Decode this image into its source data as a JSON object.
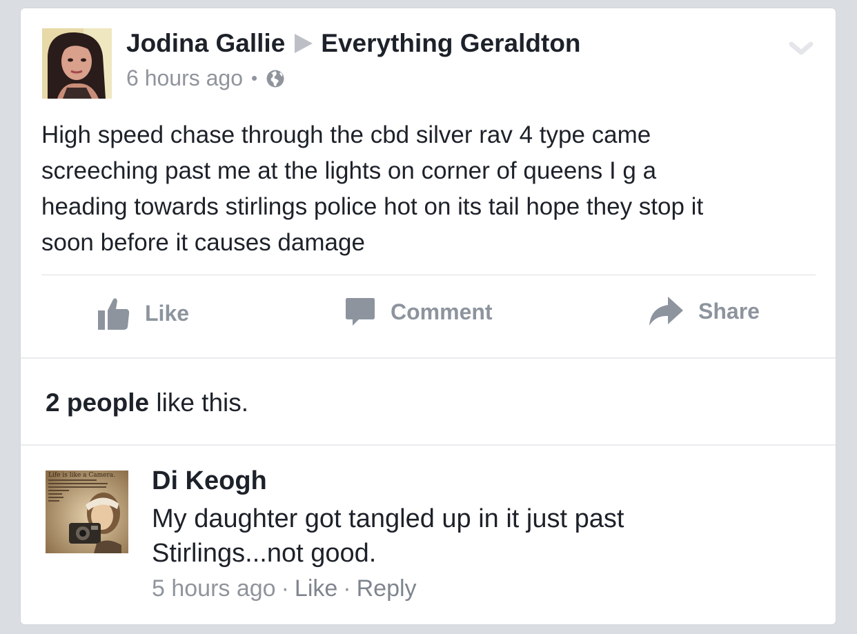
{
  "post": {
    "author": "Jodina Gallie",
    "group": "Everything Geraldton",
    "time": "6 hours ago",
    "privacy_icon": "globe-icon",
    "text_lines": [
      "High speed chase through the cbd silver rav 4 type came",
      "screeching past me at the lights on corner of queens I g a",
      "heading towards stirlings police hot on its  tail hope they stop it",
      "soon before it causes damage"
    ]
  },
  "actions": {
    "like": "Like",
    "comment": "Comment",
    "share": "Share"
  },
  "likes": {
    "count_text": "2 people",
    "suffix": " like this."
  },
  "comment": {
    "author": "Di Keogh",
    "text_lines": [
      "My daughter got tangled up in it just past",
      "Stirlings...not good."
    ],
    "time": "5 hours ago",
    "like": "Like",
    "reply": "Reply",
    "avatar_caption": "Life is like a Camera.",
    "avatar_quote": "Just focus on what's important and capture the good times, develop from the negatives and if things don't turn out, Just take another shot."
  },
  "colors": {
    "text": "#1d2129",
    "secondary": "#90949c",
    "action_gray": "#8d949e",
    "background": "#dadde2"
  }
}
